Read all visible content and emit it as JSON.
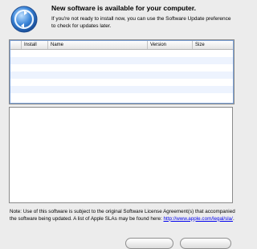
{
  "header": {
    "title": "New software is available for your computer.",
    "description": "If you're not ready to install now, you can use the Software Update preference to check for updates later."
  },
  "table": {
    "columns": [
      "Install",
      "Name",
      "Version",
      "Size"
    ],
    "rows": []
  },
  "footer": {
    "license_text": "Note: Use of this software is subject to the original Software License Agreement(s) that accompanied the software being updated. A list of Apple SLAs may be found here:",
    "license_link": "http://www.apple.com/legal/sla/",
    "license_end": "."
  }
}
